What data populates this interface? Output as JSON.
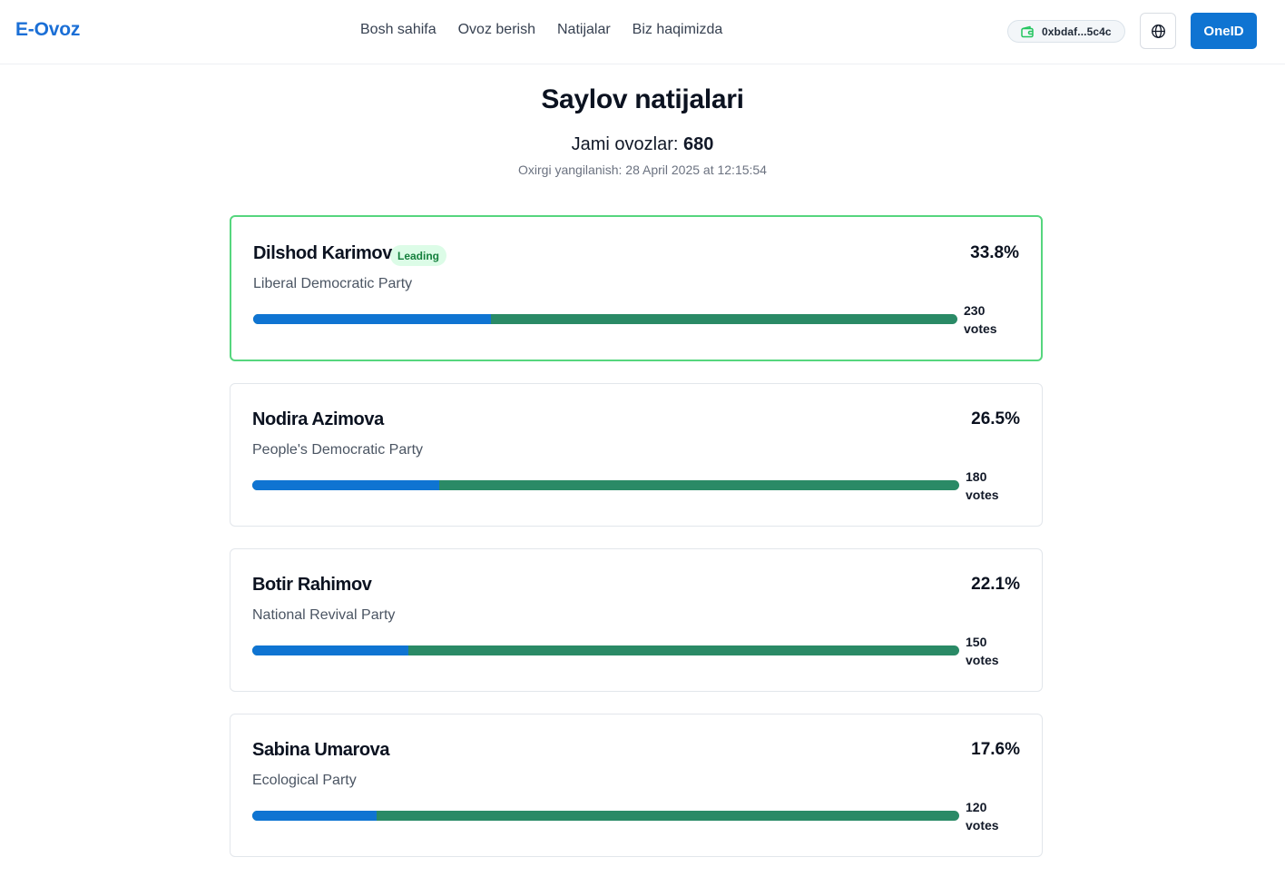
{
  "header": {
    "logo": "E-Ovoz",
    "nav": [
      "Bosh sahifa",
      "Ovoz berish",
      "Natijalar",
      "Biz haqimizda"
    ],
    "wallet_address": "0xbdaf...5c4c",
    "wallet_icon": "wallet-icon",
    "language_icon": "globe-icon",
    "login_label": "OneID"
  },
  "colors": {
    "brand": "#1b6fd6",
    "primary_button": "#0f74d2",
    "bar_fill": "#0f74d2",
    "bar_track": "#2a8a66",
    "leading_border": "#56d67e",
    "leading_badge_bg": "#dcfce7",
    "leading_badge_text": "#15803d"
  },
  "results": {
    "title": "Saylov natijalari",
    "total_label": "Jami ovozlar:",
    "total_votes": "680",
    "last_updated": "Oxirgi yangilanish: 28 April 2025 at 12:15:54",
    "votes_unit": "votes",
    "leading_label": "Leading",
    "candidates": [
      {
        "name": "Dilshod Karimov",
        "party": "Liberal Democratic Party",
        "percent": "33.8%",
        "percent_value": 33.8,
        "votes": "230",
        "leading": true
      },
      {
        "name": "Nodira Azimova",
        "party": "People's Democratic Party",
        "percent": "26.5%",
        "percent_value": 26.5,
        "votes": "180",
        "leading": false
      },
      {
        "name": "Botir Rahimov",
        "party": "National Revival Party",
        "percent": "22.1%",
        "percent_value": 22.1,
        "votes": "150",
        "leading": false
      },
      {
        "name": "Sabina Umarova",
        "party": "Ecological Party",
        "percent": "17.6%",
        "percent_value": 17.6,
        "votes": "120",
        "leading": false
      }
    ]
  }
}
